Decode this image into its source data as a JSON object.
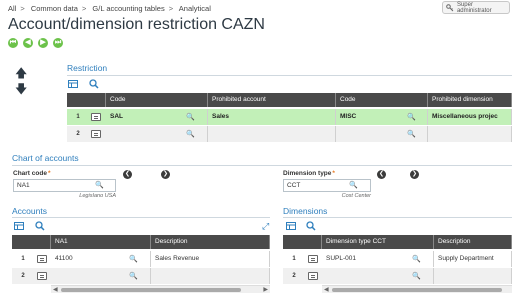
{
  "breadcrumb": [
    "All",
    "Common data",
    "G/L accounting tables",
    "Analytical"
  ],
  "user": "Super administrator",
  "title": "Account/dimension restriction CAZN",
  "nav_buttons": [
    "first-icon",
    "prev-icon",
    "next-icon",
    "last-icon"
  ],
  "restriction": {
    "section_title": "Restriction",
    "columns": [
      "Code",
      "Prohibited account",
      "Code",
      "Prohibited dimension"
    ],
    "rows": [
      {
        "num": "1",
        "code": "SAL",
        "account": "Sales",
        "code2": "MISC",
        "dimension": "Miscellaneous projec"
      },
      {
        "num": "2",
        "code": "",
        "account": "",
        "code2": "",
        "dimension": ""
      }
    ]
  },
  "chart": {
    "section_title": "Chart of accounts",
    "chart_code_label": "Chart code",
    "chart_code_value": "NA1",
    "chart_code_desc": "LegisIano USA",
    "dim_type_label": "Dimension type",
    "dim_type_value": "CCT",
    "dim_type_desc": "Cost Center"
  },
  "accounts": {
    "section_title": "Accounts",
    "columns": [
      "NA1",
      "Description"
    ],
    "rows": [
      {
        "num": "1",
        "account": "41100",
        "description": "Sales Revenue"
      },
      {
        "num": "2",
        "account": "",
        "description": ""
      }
    ]
  },
  "dimensions": {
    "section_title": "Dimensions",
    "columns": [
      "Dimension type CCT",
      "Description"
    ],
    "rows": [
      {
        "num": "1",
        "dimension": "SUPL-001",
        "description": "Supply Department"
      },
      {
        "num": "2",
        "dimension": "",
        "description": ""
      }
    ]
  },
  "colors": {
    "accent": "#2f7fbd",
    "header_dark": "#4a4a4a",
    "selected_row": "#c2f0b8",
    "nav_green": "#6cc24a",
    "required": "#e8791e"
  }
}
